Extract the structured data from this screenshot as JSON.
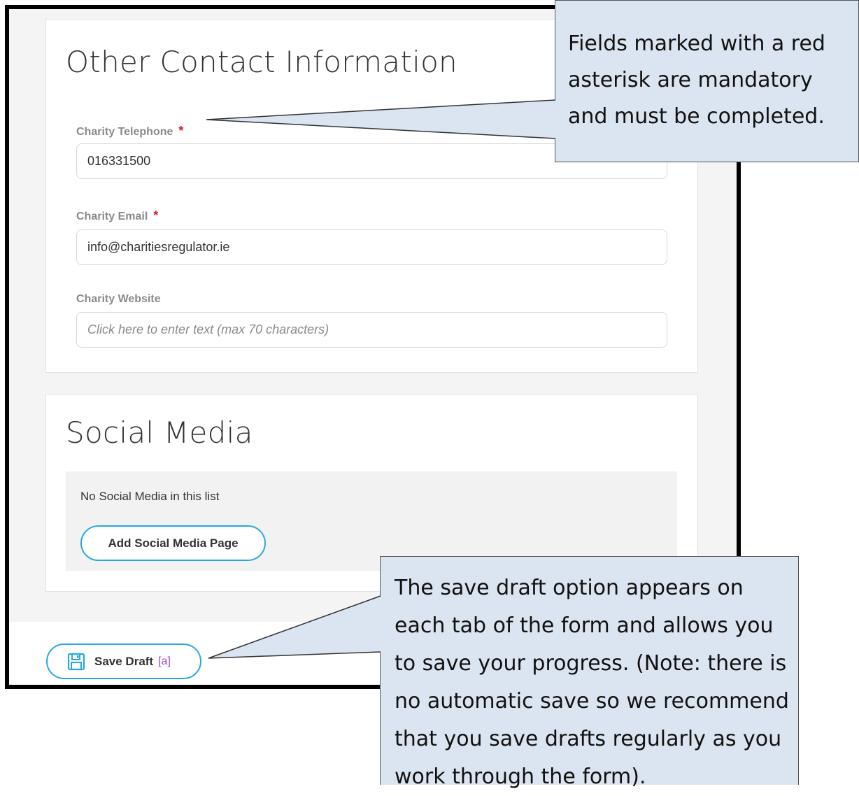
{
  "contact_section": {
    "title": "Other Contact Information",
    "fields": [
      {
        "label": "Charity Telephone",
        "required_marker": "*",
        "value": "016331500"
      },
      {
        "label": "Charity Email",
        "required_marker": "*",
        "value": "info@charitiesregulator.ie"
      },
      {
        "label": "Charity Website",
        "placeholder": "Click here to enter text (max 70 characters)"
      }
    ]
  },
  "social_section": {
    "title": "Social Media",
    "empty_message": "No Social Media in this list",
    "add_button_label": "Add Social Media Page"
  },
  "save_draft": {
    "label": "Save Draft",
    "shortcut": "[a]",
    "icon": "floppy-disk-icon"
  },
  "callouts": {
    "mandatory_note": "Fields marked with a red asterisk are mandatory and must be completed.",
    "save_draft_note": "The save draft option appears on each tab of the form and allows you to save your progress.  (Note: there is no automatic save so we recommend that you save drafts regularly as you work through the form)."
  },
  "colors": {
    "required_asterisk": "#d61f26",
    "button_border": "#29a8e0",
    "shortcut_text": "#9b4fc8",
    "callout_fill": "#dbe5f1"
  }
}
